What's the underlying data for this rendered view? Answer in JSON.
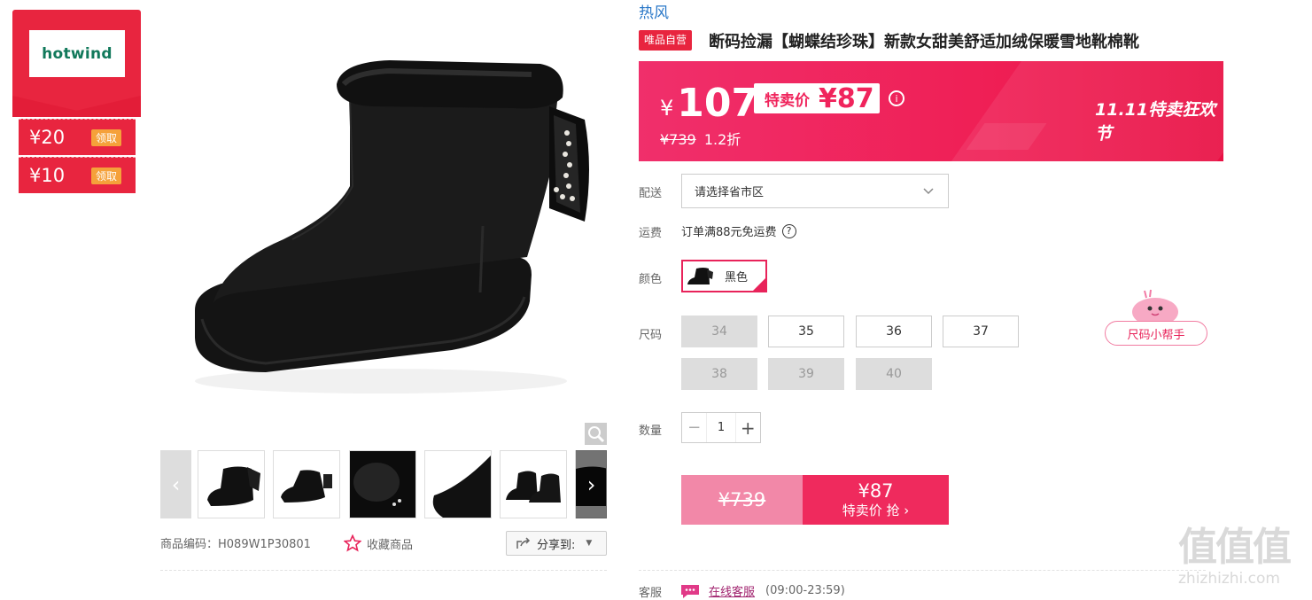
{
  "brand_card": {
    "logo_text": "hotwind",
    "coupons": [
      {
        "amount": "¥20",
        "action": "领取"
      },
      {
        "amount": "¥10",
        "action": "领取"
      }
    ]
  },
  "gallery": {
    "thumbnails": [
      "thumb-1",
      "thumb-2",
      "thumb-3",
      "thumb-4",
      "thumb-5",
      "thumb-6"
    ],
    "product_code_label": "商品编码：",
    "product_code": "H089W1P30801",
    "favorite_label": "收藏商品",
    "share_label": "分享到:"
  },
  "product": {
    "brand": "热风",
    "self_badge": "唯品自营",
    "title": "断码捡漏【蝴蝶结珍珠】新款女甜美舒适加绒保暖雪地靴棉靴"
  },
  "price": {
    "currency": "¥",
    "current": "107",
    "special_label": "特卖价",
    "special_price": "¥87",
    "original": "¥739",
    "discount": "1.2折",
    "event_logo": "11.11特卖狂欢节"
  },
  "delivery": {
    "label": "配送",
    "placeholder": "请选择省市区"
  },
  "shipping": {
    "label": "运费",
    "text": "订单满88元免运费"
  },
  "color": {
    "label": "颜色",
    "selected": "黑色"
  },
  "size": {
    "label": "尺码",
    "options": [
      {
        "value": "34",
        "available": false
      },
      {
        "value": "35",
        "available": true
      },
      {
        "value": "36",
        "available": true
      },
      {
        "value": "37",
        "available": true
      },
      {
        "value": "38",
        "available": false
      },
      {
        "value": "39",
        "available": false
      },
      {
        "value": "40",
        "available": false
      }
    ],
    "helper": "尺码小帮手"
  },
  "quantity": {
    "label": "数量",
    "minus": "−",
    "value": "1",
    "plus": "+"
  },
  "buy": {
    "original_price": "¥739",
    "special_price": "¥87",
    "action": "特卖价 抢"
  },
  "service": {
    "label": "客服",
    "link": "在线客服",
    "hours": "(09:00-23:59)"
  },
  "watermark": {
    "glyphs": "值值值",
    "site": "zhizhizhi.com"
  },
  "colors": {
    "accent": "#e8253f",
    "pink": "#ef2a5d",
    "link": "#2a78c8"
  }
}
